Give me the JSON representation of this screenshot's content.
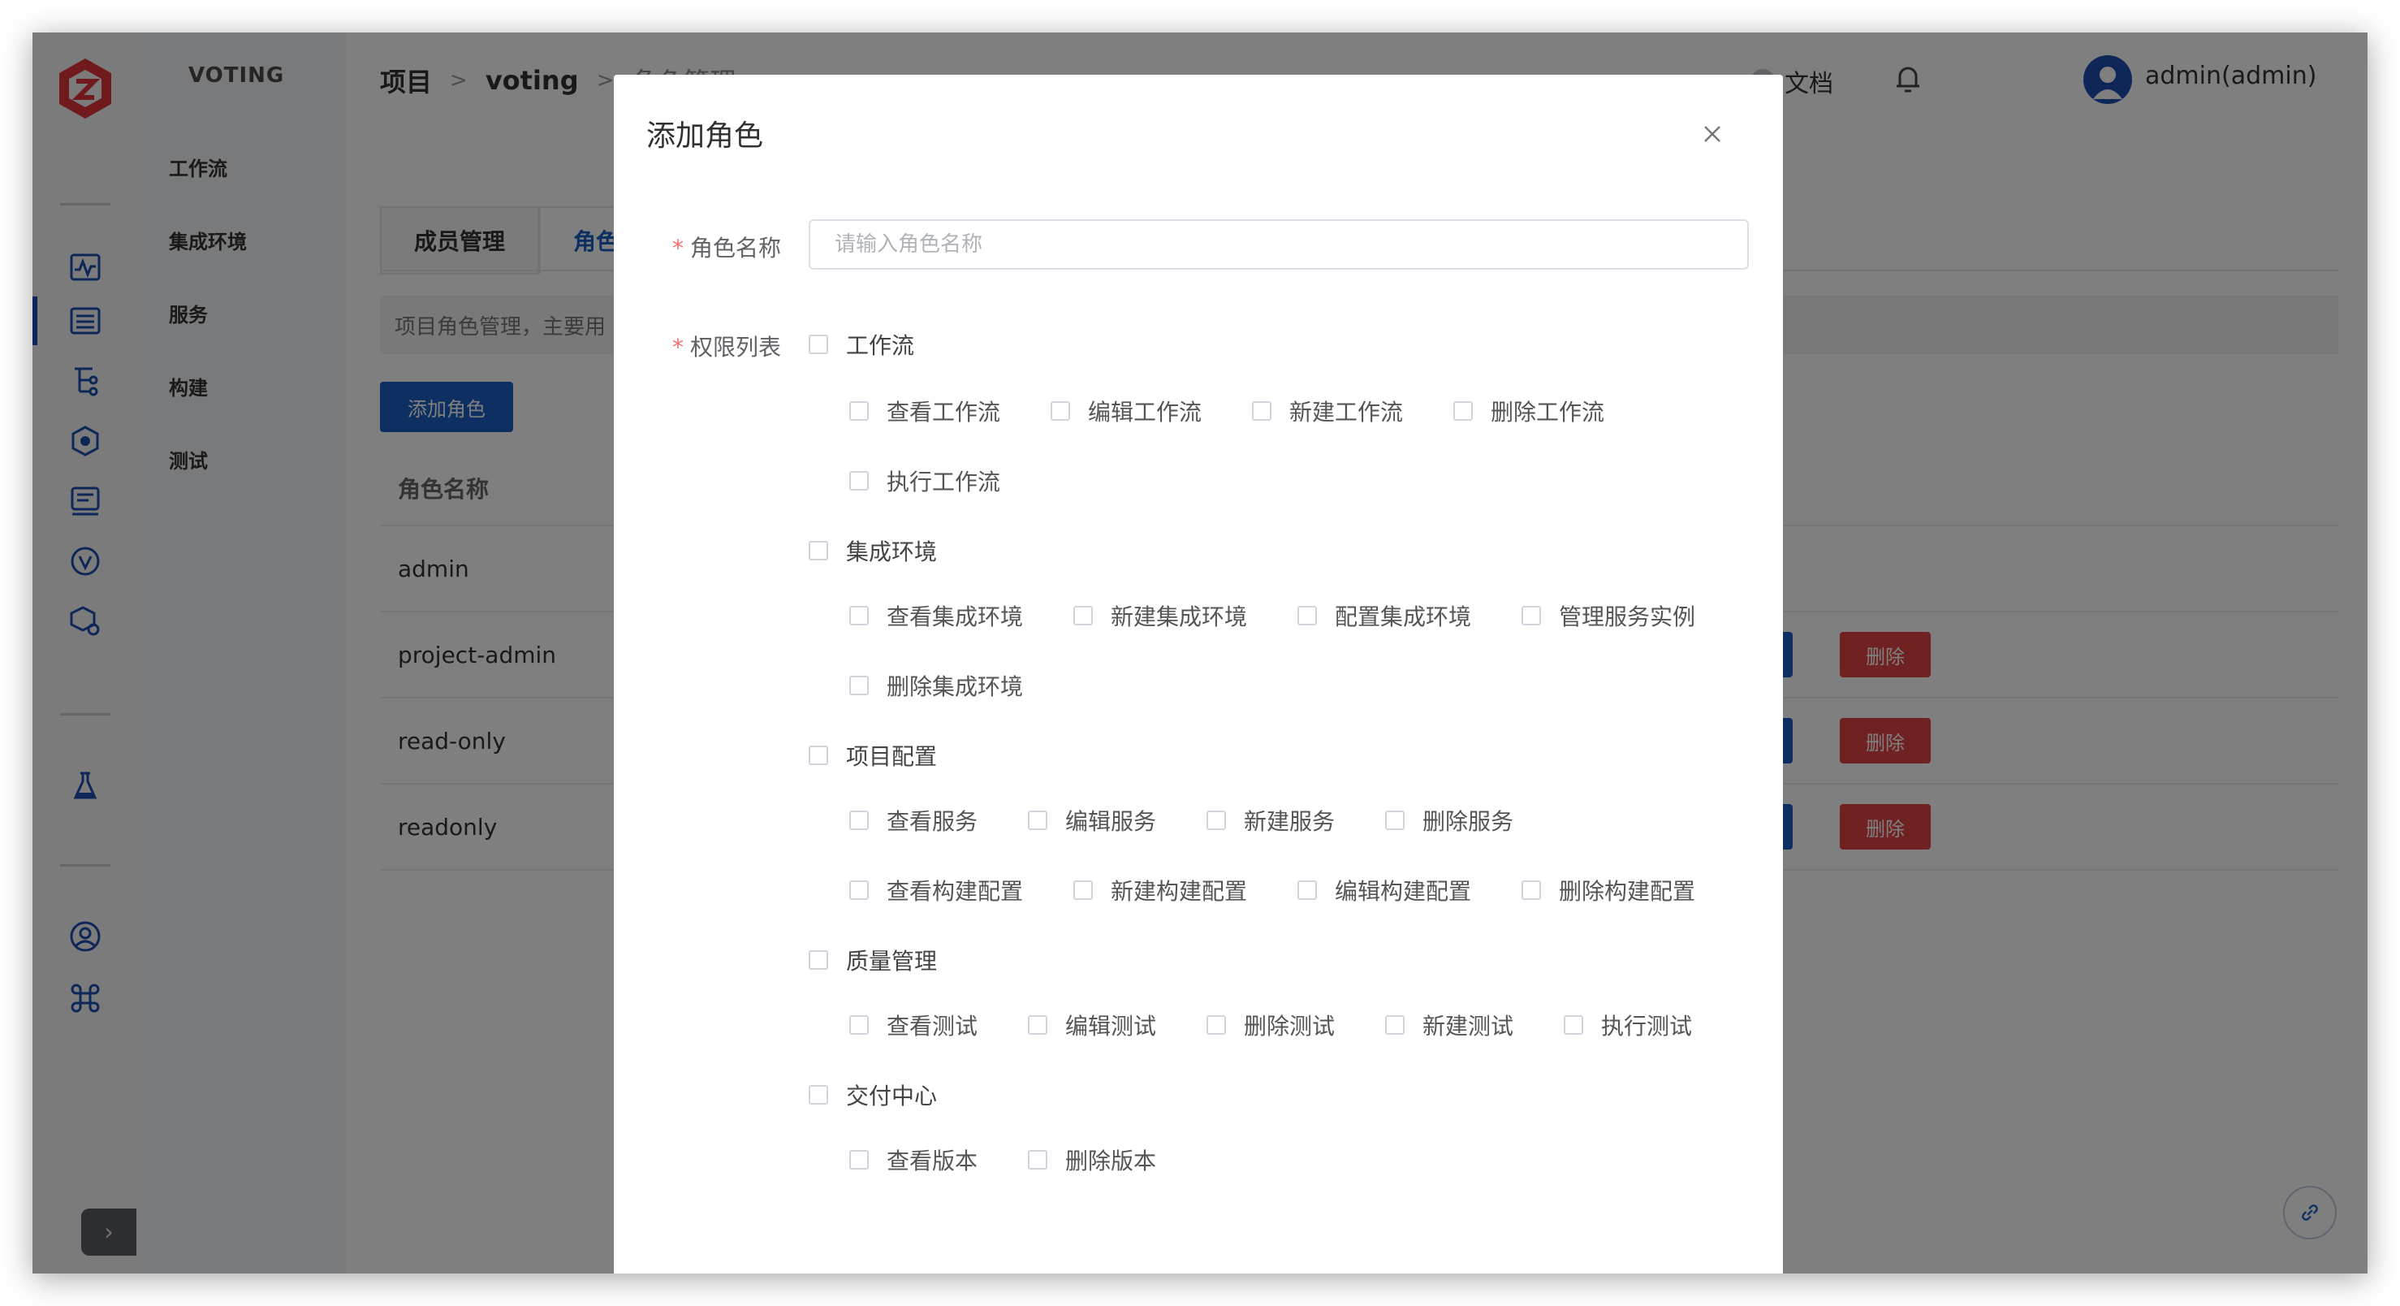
{
  "sidebar": {
    "project_name": "VOTING",
    "items": [
      {
        "label": "工作流"
      },
      {
        "label": "集成环境"
      },
      {
        "label": "服务"
      },
      {
        "label": "构建"
      },
      {
        "label": "测试"
      }
    ],
    "rail_icons": [
      "pulse-chart-icon",
      "list-icon",
      "tree-icon",
      "cube-network-icon",
      "document-icon",
      "v-circle-icon",
      "box-gear-icon",
      "flask-icon",
      "user-circle-icon",
      "command-icon"
    ]
  },
  "header": {
    "breadcrumb": [
      "项目",
      "voting",
      "角色管理"
    ],
    "breadcrumb_sep": ">",
    "docs_label": "文档",
    "user_label": "admin(admin)"
  },
  "main": {
    "tabs": [
      {
        "label": "成员管理"
      },
      {
        "label": "角色"
      }
    ],
    "description": "项目角色管理，主要用",
    "add_button_label": "添加角色",
    "table_header": "角色名称",
    "rows": [
      {
        "name": "admin"
      },
      {
        "name": "project-admin",
        "delete_label": "删除"
      },
      {
        "name": "read-only",
        "delete_label": "删除"
      },
      {
        "name": "readonly",
        "delete_label": "删除"
      }
    ]
  },
  "modal": {
    "title": "添加角色",
    "name_label": "角色名称",
    "required_mark": "*",
    "name_placeholder": "请输入角色名称",
    "name_value": "",
    "permissions_label": "权限列表",
    "groups": [
      {
        "label": "工作流",
        "checked": false,
        "items": [
          "查看工作流",
          "编辑工作流",
          "新建工作流",
          "删除工作流",
          "执行工作流"
        ]
      },
      {
        "label": "集成环境",
        "checked": false,
        "items": [
          "查看集成环境",
          "新建集成环境",
          "配置集成环境",
          "管理服务实例",
          "删除集成环境"
        ]
      },
      {
        "label": "项目配置",
        "checked": false,
        "items": [
          "查看服务",
          "编辑服务",
          "新建服务",
          "删除服务",
          "查看构建配置",
          "新建构建配置",
          "编辑构建配置",
          "删除构建配置"
        ]
      },
      {
        "label": "质量管理",
        "checked": false,
        "items": [
          "查看测试",
          "编辑测试",
          "删除测试",
          "新建测试",
          "执行测试"
        ]
      },
      {
        "label": "交付中心",
        "checked": false,
        "items": [
          "查看版本",
          "删除版本"
        ]
      }
    ]
  },
  "colors": {
    "primary": "#1d5ec5",
    "danger": "#e04343",
    "required": "#f56c6c",
    "logo": "#e0353a"
  }
}
